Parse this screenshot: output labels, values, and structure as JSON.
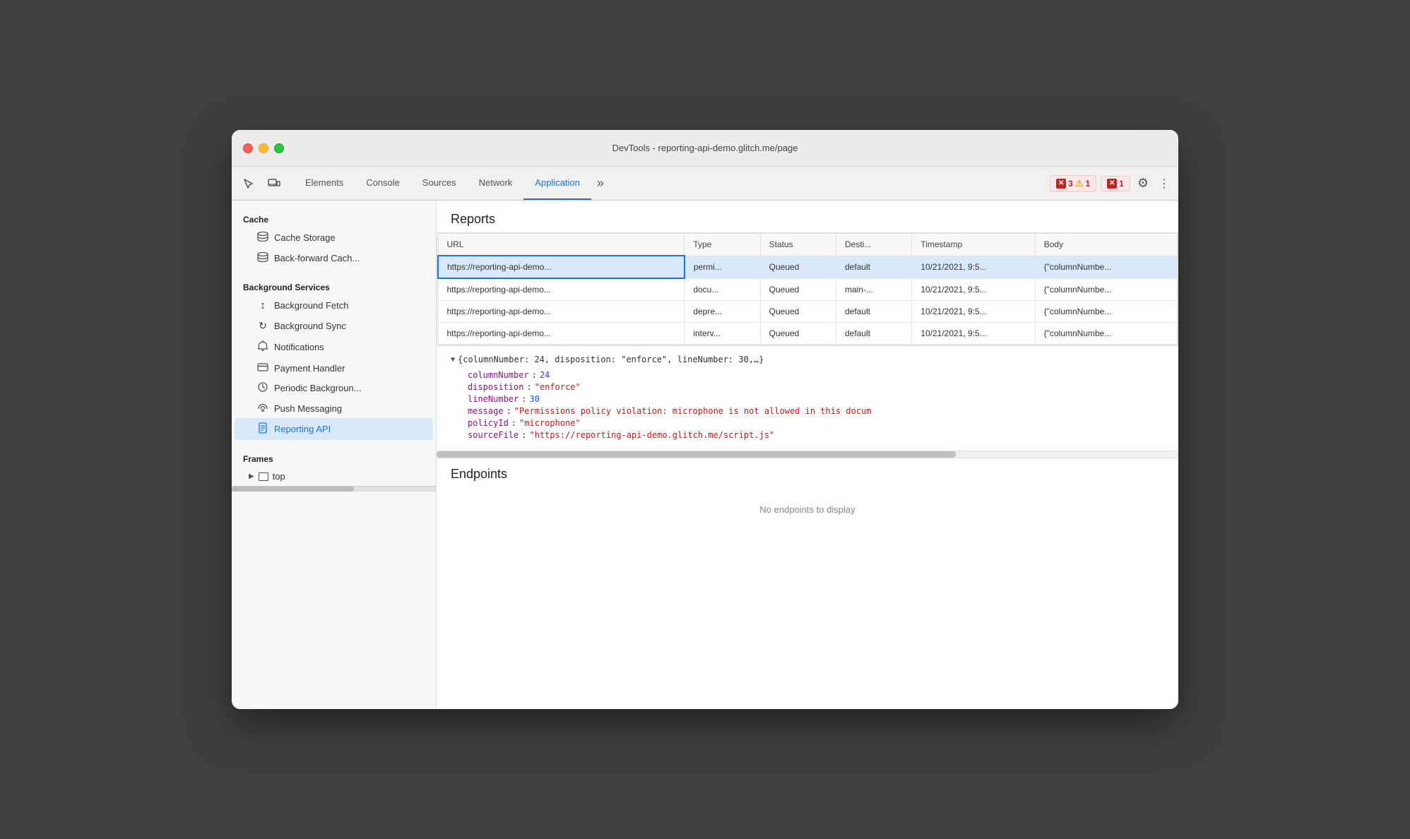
{
  "window": {
    "title": "DevTools - reporting-api-demo.glitch.me/page"
  },
  "tabs": [
    {
      "id": "elements",
      "label": "Elements",
      "active": false
    },
    {
      "id": "console",
      "label": "Console",
      "active": false
    },
    {
      "id": "sources",
      "label": "Sources",
      "active": false
    },
    {
      "id": "network",
      "label": "Network",
      "active": false
    },
    {
      "id": "application",
      "label": "Application",
      "active": true
    }
  ],
  "badges": {
    "error1": {
      "icon": "✕",
      "count": "3"
    },
    "warning": {
      "icon": "⚠",
      "count": "1"
    },
    "error2": {
      "icon": "✕",
      "count": "1"
    }
  },
  "sidebar": {
    "cache_section": "Cache",
    "cache_items": [
      {
        "id": "cache-storage",
        "label": "Cache Storage",
        "icon": "🗄"
      },
      {
        "id": "back-forward-cache",
        "label": "Back-forward Cach...",
        "icon": "🗄"
      }
    ],
    "background_services_section": "Background Services",
    "bg_items": [
      {
        "id": "background-fetch",
        "label": "Background Fetch",
        "icon": "↕"
      },
      {
        "id": "background-sync",
        "label": "Background Sync",
        "icon": "↻"
      },
      {
        "id": "notifications",
        "label": "Notifications",
        "icon": "🔔"
      },
      {
        "id": "payment-handler",
        "label": "Payment Handler",
        "icon": "⊟"
      },
      {
        "id": "periodic-background",
        "label": "Periodic Backgroun...",
        "icon": "⏱"
      },
      {
        "id": "push-messaging",
        "label": "Push Messaging",
        "icon": "☁"
      },
      {
        "id": "reporting-api",
        "label": "Reporting API",
        "icon": "📄",
        "active": true
      }
    ],
    "frames_section": "Frames",
    "frame_items": [
      {
        "id": "top",
        "label": "top"
      }
    ]
  },
  "reports": {
    "title": "Reports",
    "columns": [
      "URL",
      "Type",
      "Status",
      "Desti...",
      "Timestamp",
      "Body"
    ],
    "rows": [
      {
        "url": "https://reporting-api-demo...",
        "type": "permi...",
        "status": "Queued",
        "dest": "default",
        "timestamp": "10/21/2021, 9:5...",
        "body": "{\"columnNumbe...",
        "selected": true
      },
      {
        "url": "https://reporting-api-demo...",
        "type": "docu...",
        "status": "Queued",
        "dest": "main-...",
        "timestamp": "10/21/2021, 9:5...",
        "body": "{\"columnNumbe...",
        "selected": false
      },
      {
        "url": "https://reporting-api-demo...",
        "type": "depre...",
        "status": "Queued",
        "dest": "default",
        "timestamp": "10/21/2021, 9:5...",
        "body": "{\"columnNumbe...",
        "selected": false
      },
      {
        "url": "https://reporting-api-demo...",
        "type": "interv...",
        "status": "Queued",
        "dest": "default",
        "timestamp": "10/21/2021, 9:5...",
        "body": "{\"columnNumbe...",
        "selected": false
      }
    ],
    "detail": {
      "summary": "{columnNumber: 24, disposition: \"enforce\", lineNumber: 30,…}",
      "lines": [
        {
          "key": "columnNumber",
          "colon": ":",
          "value": "24",
          "type": "num"
        },
        {
          "key": "disposition",
          "colon": ":",
          "value": "\"enforce\"",
          "type": "string"
        },
        {
          "key": "lineNumber",
          "colon": ":",
          "value": "30",
          "type": "num"
        },
        {
          "key": "message",
          "colon": ":",
          "value": "\"Permissions policy violation: microphone is not allowed in this docum",
          "type": "string"
        },
        {
          "key": "policyId",
          "colon": ":",
          "value": "\"microphone\"",
          "type": "string"
        },
        {
          "key": "sourceFile",
          "colon": ":",
          "value": "\"https://reporting-api-demo.glitch.me/script.js\"",
          "type": "string"
        }
      ]
    }
  },
  "endpoints": {
    "title": "Endpoints",
    "empty_text": "No endpoints to display"
  }
}
